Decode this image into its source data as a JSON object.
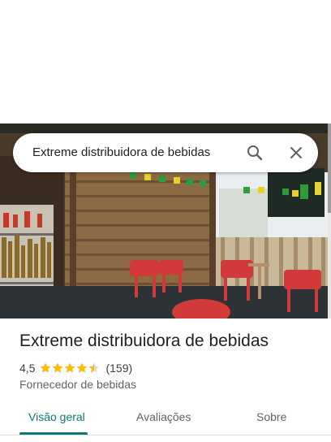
{
  "search": {
    "query": "Extreme distribuidora de bebidas"
  },
  "place": {
    "name": "Extreme distribuidora de bebidas",
    "rating": "4,5",
    "stars": 4.5,
    "reviews": "(159)",
    "category": "Fornecedor de bebidas"
  },
  "tabs": [
    {
      "label": "Visão geral",
      "active": true
    },
    {
      "label": "Avaliações",
      "active": false
    },
    {
      "label": "Sobre",
      "active": false
    }
  ],
  "icons": {
    "search": "search-icon",
    "close": "close-icon",
    "star": "star-icon"
  },
  "colors": {
    "accent": "#0b7a75",
    "star": "#fbbc04",
    "text": "#202124"
  }
}
